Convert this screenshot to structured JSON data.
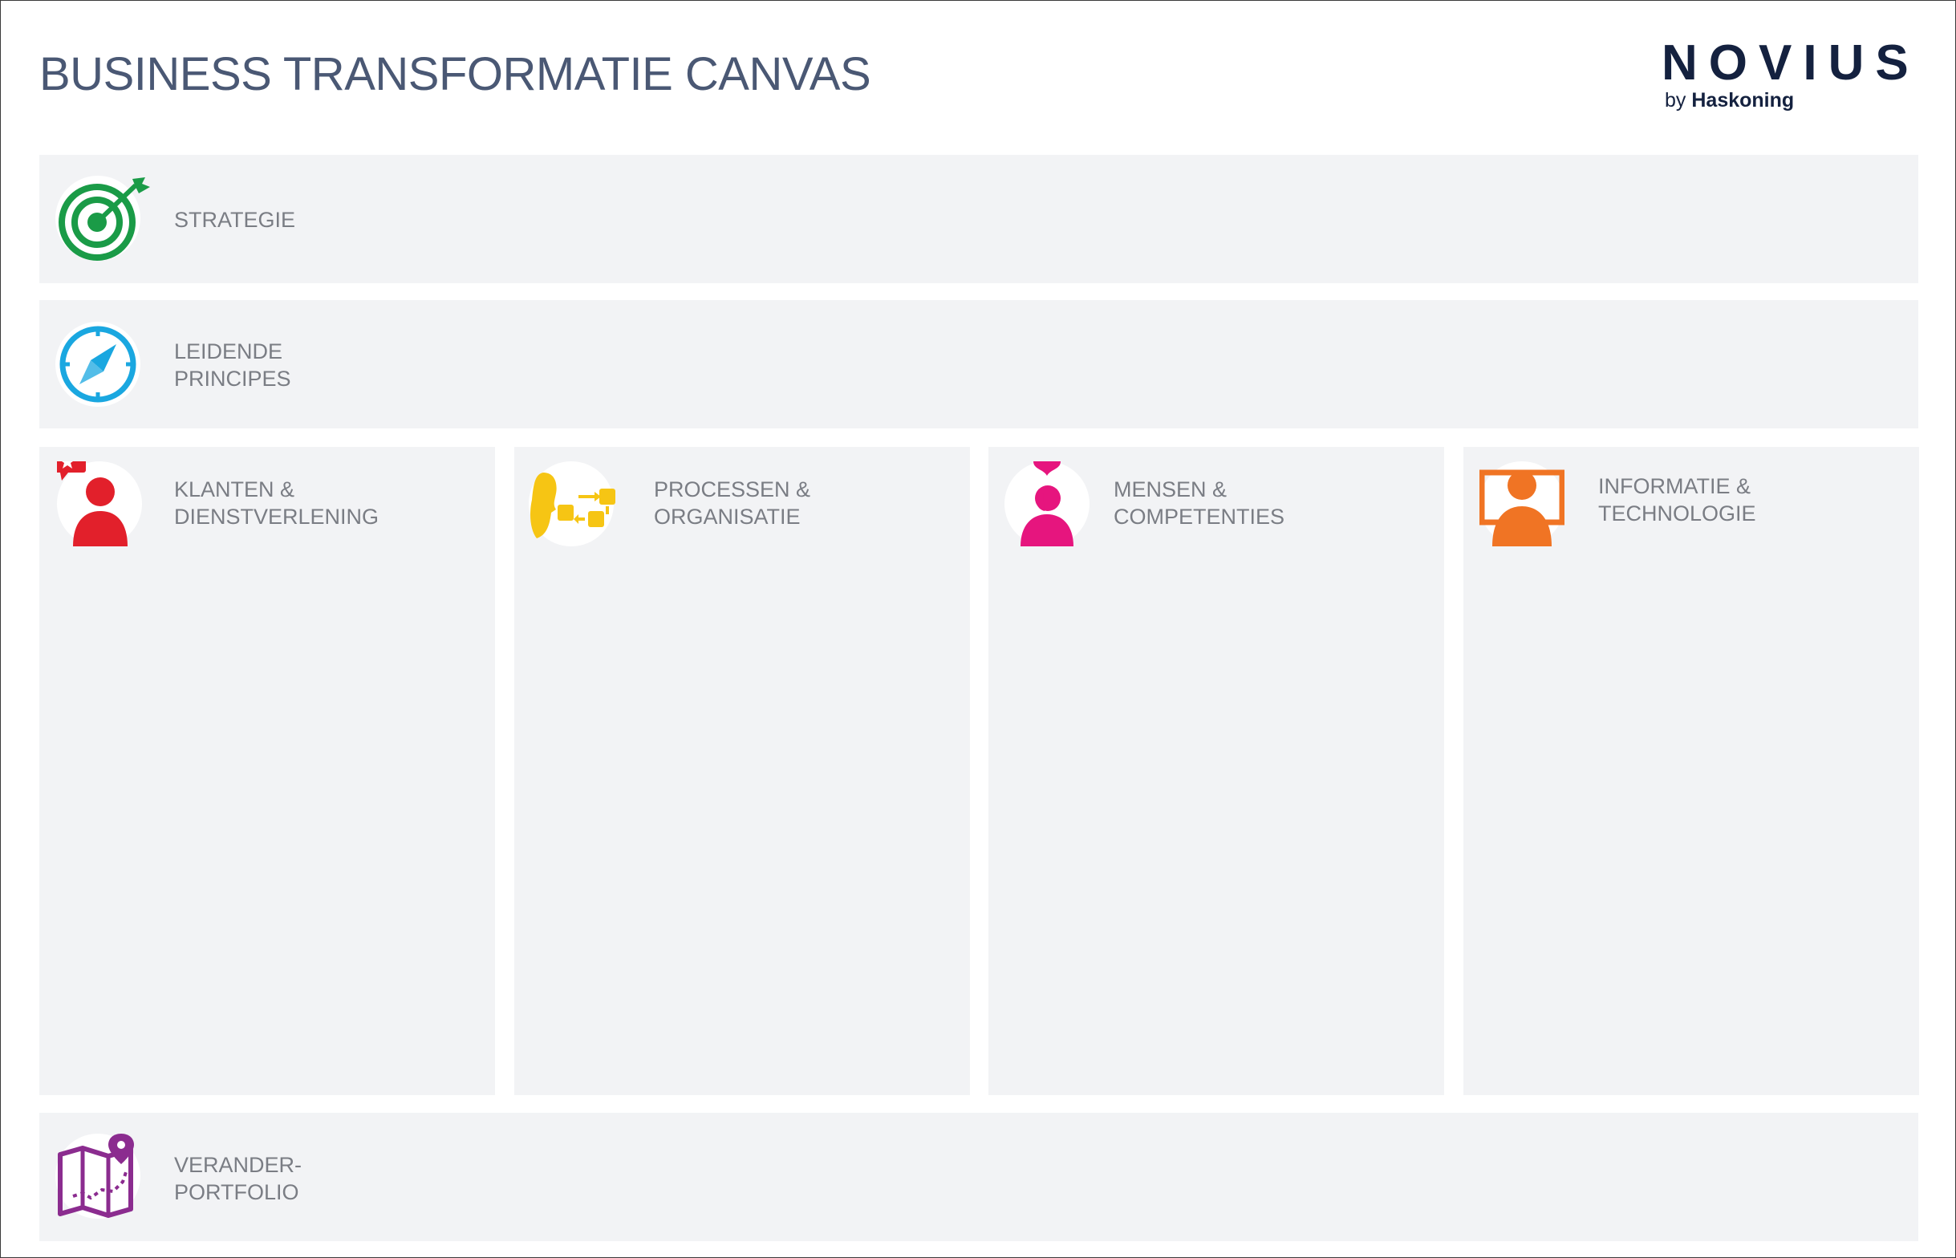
{
  "header": {
    "title": "BUSINESS TRANSFORMATIE CANVAS"
  },
  "logo": {
    "word": "NOVIUS",
    "by": "by",
    "company": "Haskoning"
  },
  "sections": {
    "strategie": {
      "line1": "STRATEGIE",
      "icon": "target-arrow-icon",
      "color": "#1a9b47"
    },
    "leidende_principes": {
      "line1": "LEIDENDE",
      "line2": "PRINCIPES",
      "icon": "compass-icon",
      "color": "#1aa7e0"
    },
    "klanten": {
      "line1": "KLANTEN &",
      "line2": "DIENSTVERLENING",
      "icon": "customer-star-icon",
      "color": "#e2202b"
    },
    "processen": {
      "line1": "PROCESSEN &",
      "line2": "ORGANISATIE",
      "icon": "process-flow-icon",
      "color": "#f6c514"
    },
    "mensen": {
      "line1": "MENSEN &",
      "line2": "COMPETENTIES",
      "icon": "person-heart-icon",
      "color": "#e6157e"
    },
    "informatie": {
      "line1": "INFORMATIE &",
      "line2": "TECHNOLOGIE",
      "icon": "person-screen-icon",
      "color": "#f07424"
    },
    "verander": {
      "line1": "VERANDER-",
      "line2": "PORTFOLIO",
      "icon": "map-pin-icon",
      "color": "#8b2c8f"
    }
  }
}
